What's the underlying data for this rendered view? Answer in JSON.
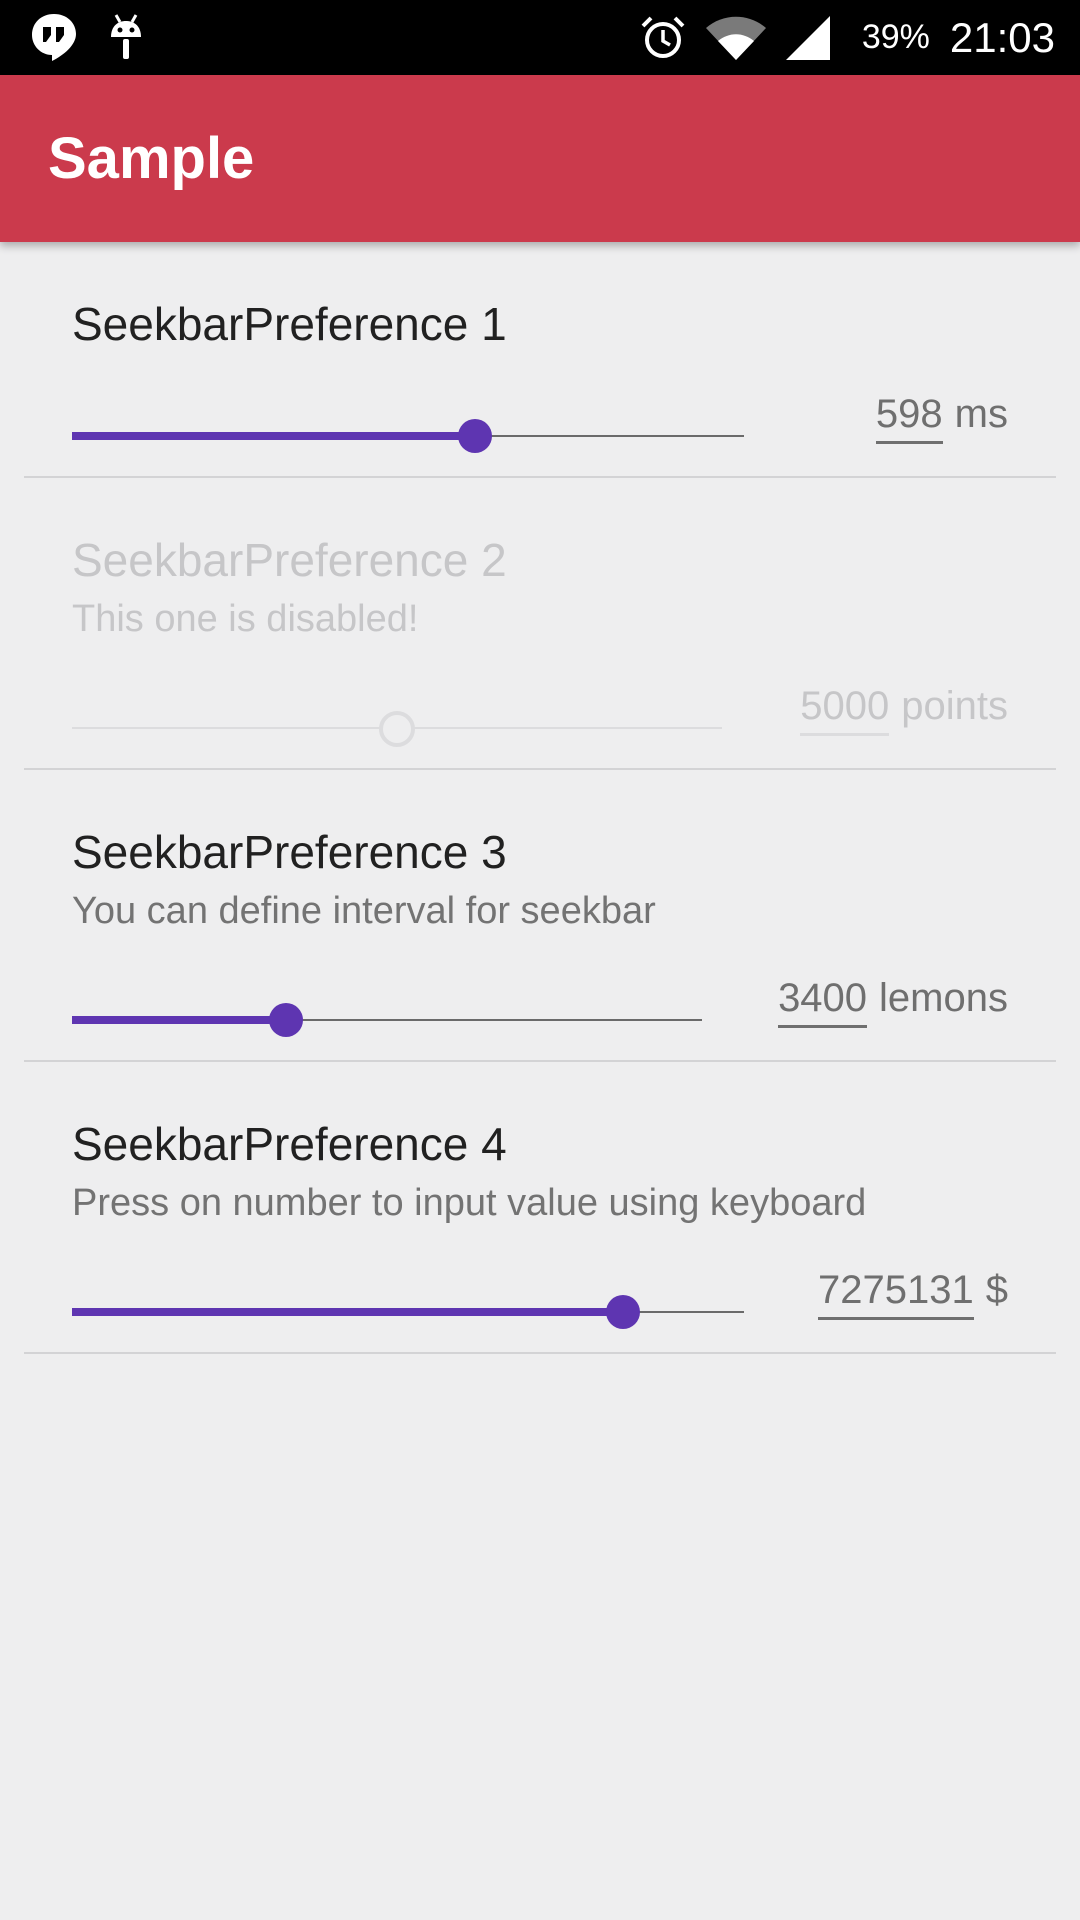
{
  "status_bar": {
    "icons_left": [
      "hangouts-icon",
      "android-debug-icon"
    ],
    "icons_right": [
      "alarm-icon",
      "wifi-icon",
      "signal-icon"
    ],
    "battery": "39%",
    "time": "21:03"
  },
  "app_bar": {
    "title": "Sample",
    "color": "#cb3a4c"
  },
  "accent_color": "#5e35b1",
  "preferences": [
    {
      "title": "SeekbarPreference 1",
      "summary": "",
      "value": "598",
      "unit": "ms",
      "enabled": true,
      "fraction": 0.6
    },
    {
      "title": "SeekbarPreference 2",
      "summary": "This one is disabled!",
      "value": "5000",
      "unit": "points",
      "enabled": false,
      "fraction": 0.5
    },
    {
      "title": "SeekbarPreference 3",
      "summary": "You can define interval for seekbar",
      "value": "3400",
      "unit": "lemons",
      "enabled": true,
      "fraction": 0.34
    },
    {
      "title": "SeekbarPreference 4",
      "summary": "Press on number to input value using keyboard",
      "value": "7275131",
      "unit": "$",
      "enabled": true,
      "fraction": 0.82
    }
  ]
}
